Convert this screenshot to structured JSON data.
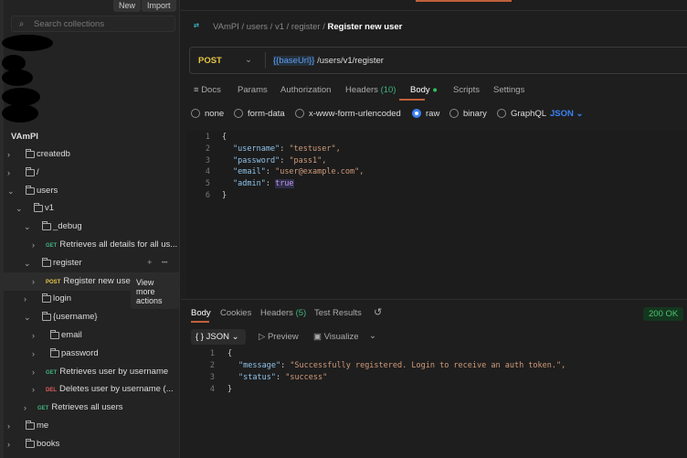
{
  "sidebar": {
    "new_label": "New",
    "import_label": "Import",
    "search_placeholder": "Search collections",
    "collection": "VAmPI",
    "tree": [
      {
        "type": "folder",
        "label": "createdb",
        "expanded": false
      },
      {
        "type": "folder",
        "label": "/",
        "expanded": false
      },
      {
        "type": "folder",
        "label": "users",
        "expanded": true
      },
      {
        "type": "folder",
        "label": "v1",
        "expanded": true
      },
      {
        "type": "folder",
        "label": "_debug",
        "expanded": true
      },
      {
        "type": "request",
        "method": "GET",
        "label": "Retrieves all details for all us..."
      },
      {
        "type": "folder",
        "label": "register",
        "expanded": true
      },
      {
        "type": "request",
        "method": "POST",
        "label": "Register new user"
      },
      {
        "type": "folder",
        "label": "login",
        "expanded": false
      },
      {
        "type": "folder",
        "label": "{username}",
        "expanded": true
      },
      {
        "type": "folder",
        "label": "email",
        "expanded": false
      },
      {
        "type": "folder",
        "label": "password",
        "expanded": false
      },
      {
        "type": "request",
        "method": "GET",
        "label": "Retrieves user by username"
      },
      {
        "type": "request",
        "method": "DEL",
        "label": "Deletes user by username (..."
      },
      {
        "type": "request",
        "method": "GET",
        "label": "Retrieves all users"
      },
      {
        "type": "folder",
        "label": "me",
        "expanded": false
      },
      {
        "type": "folder",
        "label": "books",
        "expanded": false
      }
    ],
    "tooltip": "View more actions"
  },
  "method_colors": {
    "GET": "#3fb27f",
    "POST": "#e8c547",
    "DEL": "#e05d5d"
  },
  "breadcrumb": {
    "items": [
      "VAmPI",
      "users",
      "v1",
      "register"
    ],
    "current": "Register new user"
  },
  "request": {
    "method": "POST",
    "base_var": "{{baseUrl}}",
    "path": " /users/v1/register"
  },
  "req_tabs": {
    "docs": "Docs",
    "params": "Params",
    "auth": "Authorization",
    "headers": "Headers",
    "headers_count": "(10)",
    "body": "Body",
    "scripts": "Scripts",
    "settings": "Settings"
  },
  "body_modes": {
    "none": "none",
    "form": "form-data",
    "urlenc": "x-www-form-urlencoded",
    "raw": "raw",
    "binary": "binary",
    "graphql": "GraphQL",
    "lang": "JSON",
    "selected": "raw"
  },
  "request_body": [
    {
      "n": "1",
      "text": "{"
    },
    {
      "n": "2",
      "key": "\"username\"",
      "val": "\"testuser\","
    },
    {
      "n": "3",
      "key": "\"password\"",
      "val": "\"pass1\","
    },
    {
      "n": "4",
      "key": "\"email\"",
      "val": "\"user@example.com\","
    },
    {
      "n": "5",
      "key": "\"admin\"",
      "val": "true"
    },
    {
      "n": "6",
      "text": "}"
    }
  ],
  "response": {
    "tabs": {
      "body": "Body",
      "cookies": "Cookies",
      "headers": "Headers",
      "headers_count": "(5)",
      "tests": "Test Results"
    },
    "status": "200 OK",
    "format": "JSON",
    "preview": "Preview",
    "visualize": "Visualize",
    "lines": [
      {
        "n": "1",
        "text": "{"
      },
      {
        "n": "2",
        "key": "\"message\"",
        "val": "\"Successfully registered. Login to receive an auth token.\","
      },
      {
        "n": "3",
        "key": "\"status\"",
        "val": "\"success\""
      },
      {
        "n": "4",
        "text": "}"
      }
    ]
  }
}
